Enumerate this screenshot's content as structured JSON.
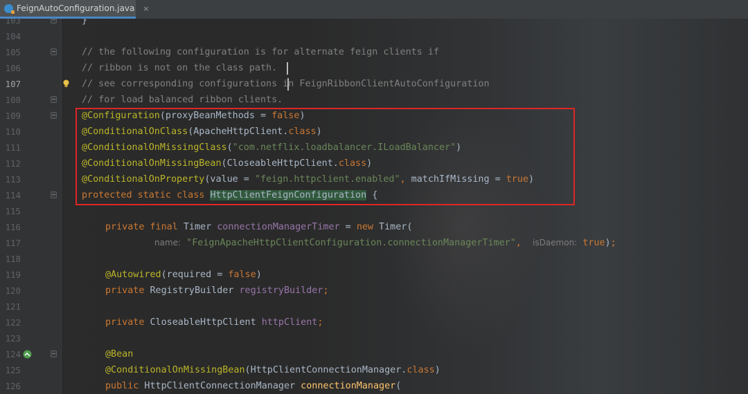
{
  "tab": {
    "title": "FeignAutoConfiguration.java",
    "close": "×"
  },
  "lines": [
    {
      "n": "103",
      "t": "}"
    },
    {
      "n": "104",
      "t": ""
    },
    {
      "n": "105",
      "t": "// the following configuration is for alternate feign clients if"
    },
    {
      "n": "106",
      "t": "// ribbon is not on the class path."
    },
    {
      "n": "107",
      "t": "// see corresponding configurations in FeignRibbonClientAutoConfiguration"
    },
    {
      "n": "108",
      "t": "// for load balanced ribbon clients."
    },
    {
      "n": "109",
      "t": "@Configuration(proxyBeanMethods = false)"
    },
    {
      "n": "110",
      "t": "@ConditionalOnClass(ApacheHttpClient.class)"
    },
    {
      "n": "111",
      "t": "@ConditionalOnMissingClass(\"com.netflix.loadbalancer.ILoadBalancer\")"
    },
    {
      "n": "112",
      "t": "@ConditionalOnMissingBean(CloseableHttpClient.class)"
    },
    {
      "n": "113",
      "t": "@ConditionalOnProperty(value = \"feign.httpclient.enabled\", matchIfMissing = true)"
    },
    {
      "n": "114",
      "t": "protected static class HttpClientFeignConfiguration {"
    },
    {
      "n": "115",
      "t": ""
    },
    {
      "n": "116",
      "t": "private final Timer connectionManagerTimer = new Timer("
    },
    {
      "n": "117",
      "t": "name: \"FeignApacheHttpClientConfiguration.connectionManagerTimer\",  isDaemon: true);"
    },
    {
      "n": "118",
      "t": ""
    },
    {
      "n": "119",
      "t": "@Autowired(required = false)"
    },
    {
      "n": "120",
      "t": "private RegistryBuilder registryBuilder;"
    },
    {
      "n": "121",
      "t": ""
    },
    {
      "n": "122",
      "t": "private CloseableHttpClient httpClient;"
    },
    {
      "n": "123",
      "t": ""
    },
    {
      "n": "124",
      "t": "@Bean"
    },
    {
      "n": "125",
      "t": "@ConditionalOnMissingBean(HttpClientConnectionManager.class)"
    },
    {
      "n": "126",
      "t": "public HttpClientConnectionManager connectionManager("
    }
  ],
  "colors": {
    "comment": "#808080",
    "annotation": "#bbb529",
    "keyword": "#cc7832",
    "string": "#6a8759",
    "field": "#9876aa",
    "method": "#ffc66d",
    "text": "#a9b7c6",
    "highlight_box": "#e02626"
  },
  "icons": [
    "java-class-file-icon",
    "close-tab-icon",
    "intention-bulb-icon",
    "run-gutter-icon",
    "fold-marker-icon"
  ]
}
